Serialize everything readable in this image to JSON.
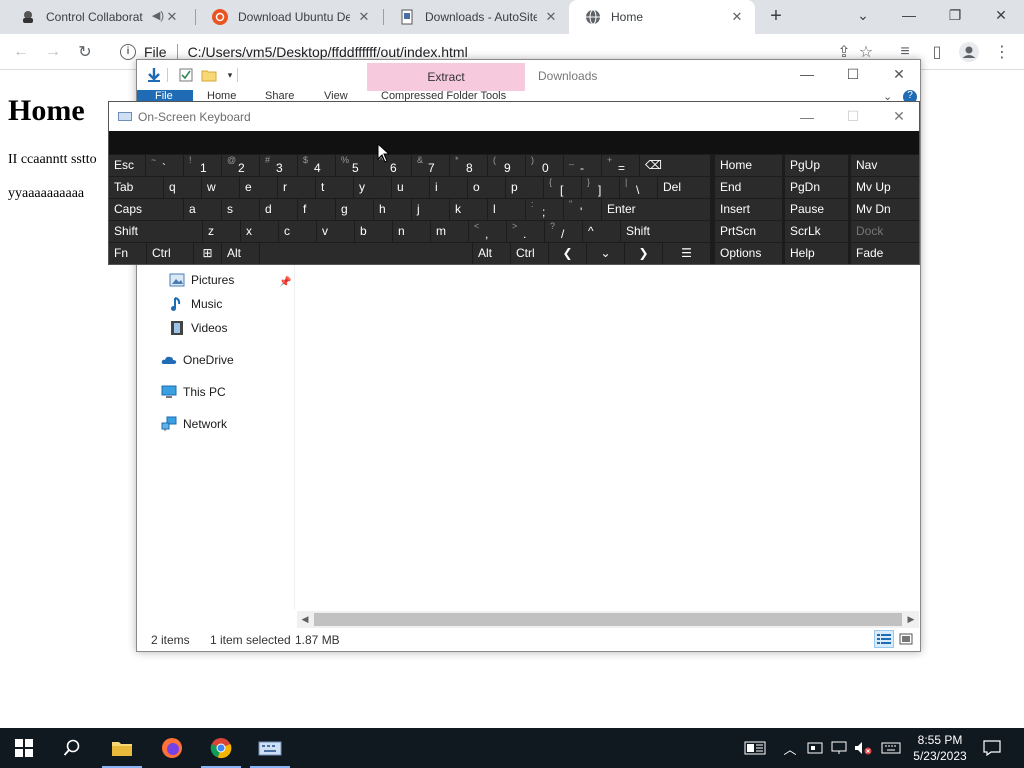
{
  "browser": {
    "tabs": [
      {
        "label": "Control Collaborat",
        "icon": "collab-icon"
      },
      {
        "label": "Download Ubuntu Des",
        "icon": "ubuntu-icon"
      },
      {
        "label": "Downloads - AutoSite",
        "icon": "autosite-icon"
      },
      {
        "label": "Home",
        "icon": "globe-icon"
      }
    ],
    "address_scheme": "File",
    "address_url": "C:/Users/vm5/Desktop/ffddffffff/out/index.html"
  },
  "page": {
    "heading": "Home",
    "para1": "II ccaanntt sstto",
    "para2": "yyaaaaaaaaaa"
  },
  "explorer": {
    "extract_label": "Extract",
    "title": "Downloads",
    "ribbon_tabs": [
      "File",
      "Home",
      "Share",
      "View",
      "Compressed Folder Tools"
    ],
    "nav": [
      {
        "label": "Pictures",
        "icon": "pictures-icon"
      },
      {
        "label": "Music",
        "icon": "music-icon"
      },
      {
        "label": "Videos",
        "icon": "videos-icon"
      },
      {
        "label": "OneDrive",
        "icon": "onedrive-icon"
      },
      {
        "label": "This PC",
        "icon": "this-pc-icon"
      },
      {
        "label": "Network",
        "icon": "network-icon"
      }
    ],
    "status_items": "2 items",
    "status_selected": "1 item selected",
    "status_size": "1.87 MB"
  },
  "osk": {
    "title": "On-Screen Keyboard",
    "row1": [
      {
        "main": "Esc"
      },
      {
        "sub": "~",
        "main": "`"
      },
      {
        "sub": "!",
        "main": "1"
      },
      {
        "sub": "@",
        "main": "2"
      },
      {
        "sub": "#",
        "main": "3"
      },
      {
        "sub": "$",
        "main": "4"
      },
      {
        "sub": "%",
        "main": "5"
      },
      {
        "sub": "^",
        "main": "6"
      },
      {
        "sub": "&",
        "main": "7"
      },
      {
        "sub": "*",
        "main": "8"
      },
      {
        "sub": "(",
        "main": "9"
      },
      {
        "sub": ")",
        "main": "0"
      },
      {
        "sub": "_",
        "main": "-"
      },
      {
        "sub": "+",
        "main": "="
      },
      {
        "main": "⌫"
      }
    ],
    "row2": [
      "Tab",
      "q",
      "w",
      "e",
      "r",
      "t",
      "y",
      "u",
      "i",
      "o",
      "p",
      "[",
      "]",
      "\\",
      "Del"
    ],
    "row2_subs": [
      "",
      "",
      "",
      "",
      "",
      "",
      "",
      "",
      "",
      "",
      "",
      "{",
      "}",
      "|",
      ""
    ],
    "row3": [
      "Caps",
      "a",
      "s",
      "d",
      "f",
      "g",
      "h",
      "j",
      "k",
      "l",
      ";",
      "'",
      "Enter"
    ],
    "row3_subs": [
      "",
      "",
      "",
      "",
      "",
      "",
      "",
      "",
      "",
      "",
      ":",
      "\"",
      ""
    ],
    "row4": [
      "Shift",
      "z",
      "x",
      "c",
      "v",
      "b",
      "n",
      "m",
      ",",
      ".",
      "/",
      "^",
      "Shift"
    ],
    "row4_subs": [
      "",
      "",
      "",
      "",
      "",
      "",
      "",
      "",
      "<",
      ">",
      "?",
      "",
      ""
    ],
    "row5": [
      "Fn",
      "Ctrl",
      "Win",
      "Alt",
      "",
      "Alt",
      "Ctrl",
      "<",
      "v",
      ">",
      "Menu"
    ],
    "nav_keys": [
      [
        "Home",
        "PgUp",
        "Nav"
      ],
      [
        "End",
        "PgDn",
        "Mv Up"
      ],
      [
        "Insert",
        "Pause",
        "Mv Dn"
      ],
      [
        "PrtScn",
        "ScrLk",
        "Dock"
      ],
      [
        "Options",
        "Help",
        "Fade"
      ]
    ]
  },
  "taskbar": {
    "time": "8:55 PM",
    "date": "5/23/2023"
  }
}
